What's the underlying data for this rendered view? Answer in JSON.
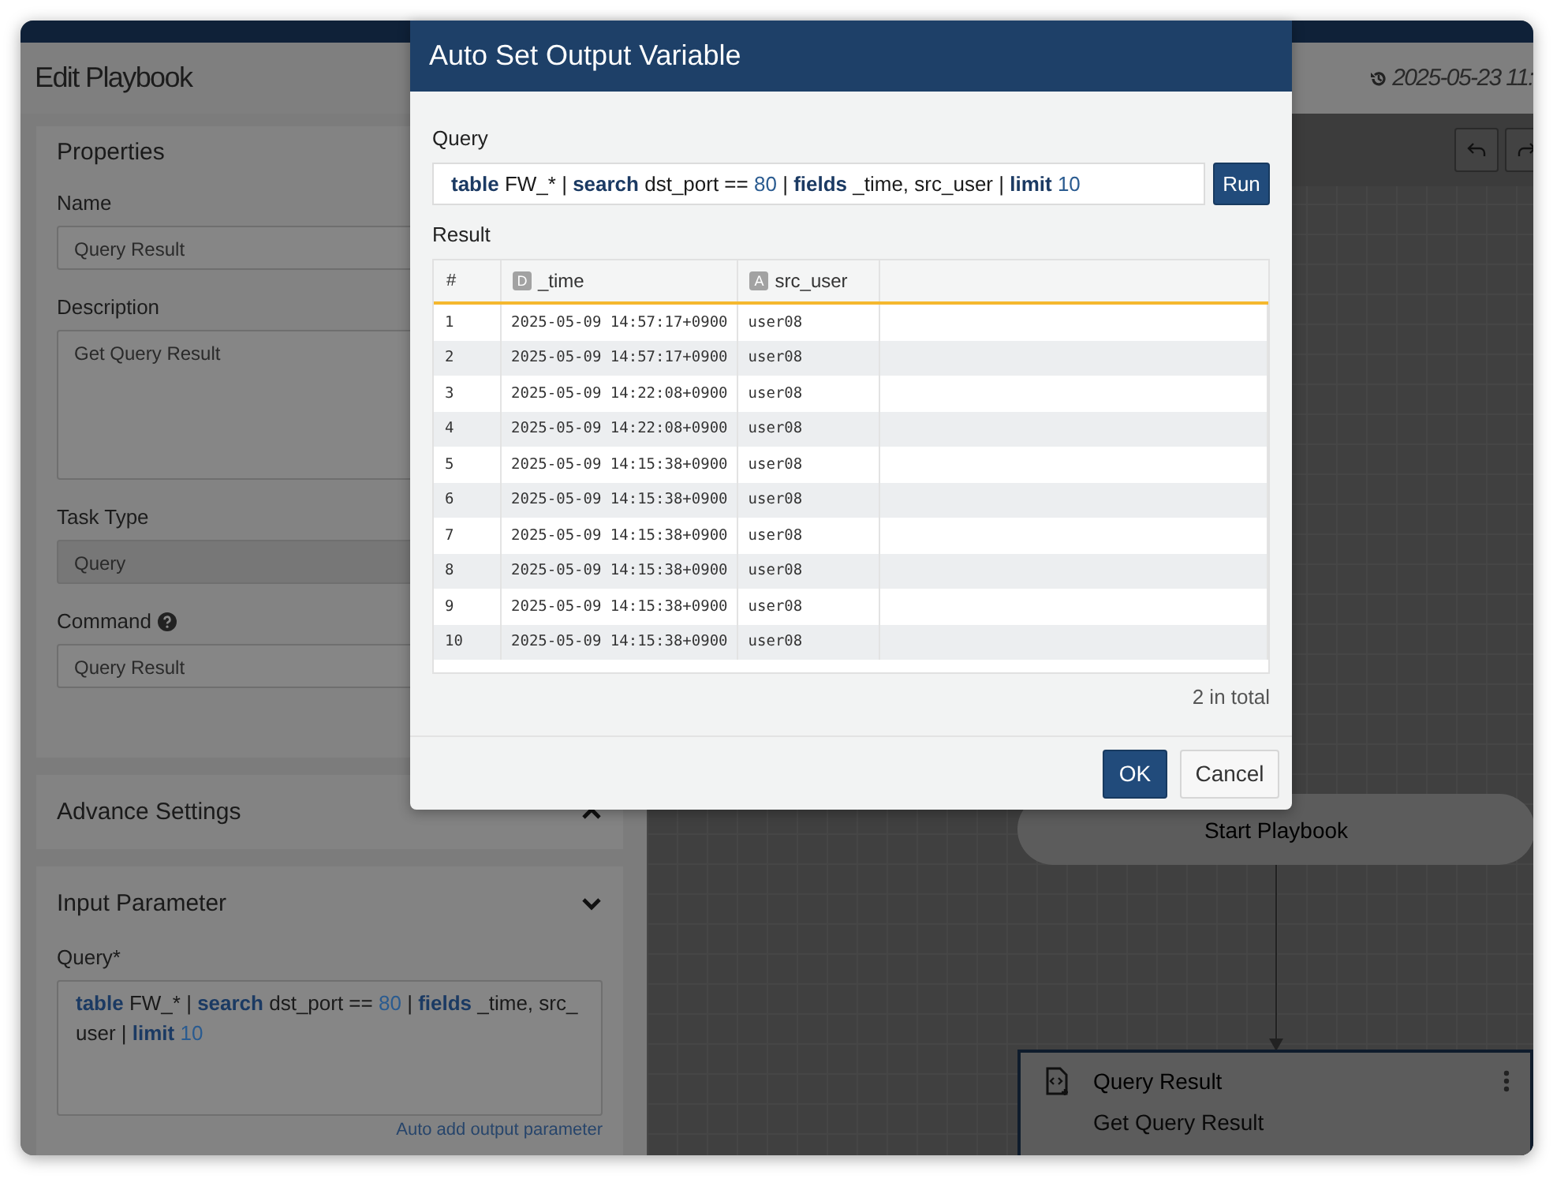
{
  "header": {
    "title": "Edit Playbook",
    "timestamp": "2025-05-23 11:"
  },
  "properties": {
    "title": "Properties",
    "fields": [
      {
        "label": "Name",
        "value": "Query Result",
        "kind": "input",
        "help": false
      },
      {
        "label": "Description",
        "value": "Get Query Result",
        "kind": "textarea",
        "help": false
      },
      {
        "label": "Task Type",
        "value": "Query",
        "kind": "select",
        "help": false
      },
      {
        "label": "Command",
        "value": "Query Result",
        "kind": "input",
        "help": true
      }
    ]
  },
  "sections": [
    {
      "title": "Advance Settings",
      "expanded": false
    },
    {
      "title": "Input Parameter",
      "expanded": true,
      "field_label": "Query*",
      "query": [
        {
          "kind": "keyword",
          "text": "table"
        },
        {
          "kind": "text",
          "text": " FW_* | "
        },
        {
          "kind": "keyword",
          "text": "search"
        },
        {
          "kind": "text",
          "text": " dst_port == "
        },
        {
          "kind": "number",
          "text": "80"
        },
        {
          "kind": "text",
          "text": " | "
        },
        {
          "kind": "keyword",
          "text": "fields"
        },
        {
          "kind": "text",
          "text": " _time, src_user | "
        },
        {
          "kind": "keyword",
          "text": "limit"
        },
        {
          "kind": "number",
          "text": " 10"
        }
      ],
      "link": "Auto add output parameter"
    }
  ],
  "canvas": {
    "start_node": "Start Playbook",
    "task_node": {
      "title": "Query Result",
      "description": "Get Query Result"
    }
  },
  "modal": {
    "title": "Auto Set Output Variable",
    "query_label": "Query",
    "query": [
      {
        "kind": "keyword",
        "text": "table"
      },
      {
        "kind": "text",
        "text": " FW_* | "
      },
      {
        "kind": "keyword",
        "text": "search"
      },
      {
        "kind": "text",
        "text": " dst_port == "
      },
      {
        "kind": "number",
        "text": "80"
      },
      {
        "kind": "text",
        "text": " | "
      },
      {
        "kind": "keyword",
        "text": "fields"
      },
      {
        "kind": "text",
        "text": " _time, src_user | "
      },
      {
        "kind": "keyword",
        "text": "limit"
      },
      {
        "kind": "number",
        "text": " 10"
      }
    ],
    "run_button": "Run",
    "result_label": "Result",
    "columns": [
      {
        "label": "#"
      },
      {
        "label": "_time",
        "type_badge": "D"
      },
      {
        "label": "src_user",
        "type_badge": "A"
      }
    ],
    "rows": [
      [
        "1",
        "2025-05-09 14:57:17+0900",
        "user08"
      ],
      [
        "2",
        "2025-05-09 14:57:17+0900",
        "user08"
      ],
      [
        "3",
        "2025-05-09 14:22:08+0900",
        "user08"
      ],
      [
        "4",
        "2025-05-09 14:22:08+0900",
        "user08"
      ],
      [
        "5",
        "2025-05-09 14:15:38+0900",
        "user08"
      ],
      [
        "6",
        "2025-05-09 14:15:38+0900",
        "user08"
      ],
      [
        "7",
        "2025-05-09 14:15:38+0900",
        "user08"
      ],
      [
        "8",
        "2025-05-09 14:15:38+0900",
        "user08"
      ],
      [
        "9",
        "2025-05-09 14:15:38+0900",
        "user08"
      ],
      [
        "10",
        "2025-05-09 14:15:38+0900",
        "user08"
      ]
    ],
    "total": "2 in total",
    "buttons": [
      {
        "label": "OK",
        "kind": "primary"
      },
      {
        "label": "Cancel",
        "kind": "secondary"
      }
    ]
  }
}
